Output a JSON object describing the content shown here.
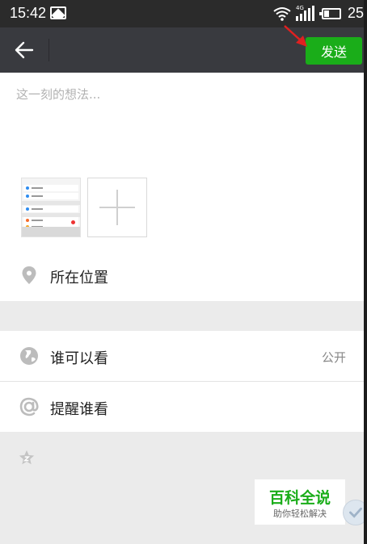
{
  "status_bar": {
    "time": "15:42",
    "network_label": "4G",
    "battery_level": "25",
    "icons": [
      "image-icon",
      "wifi-icon",
      "signal-icon",
      "battery-icon"
    ]
  },
  "toolbar": {
    "send_label": "发送",
    "send_color": "#1aad19",
    "background": "#393a3f"
  },
  "composer": {
    "placeholder": "这一刻的想法..."
  },
  "options": {
    "location_label": "所在位置",
    "visibility_label": "谁可以看",
    "visibility_value": "公开",
    "mention_label": "提醒谁看"
  },
  "watermark": {
    "title": "百科全说",
    "subtitle": "助你轻松解决"
  }
}
